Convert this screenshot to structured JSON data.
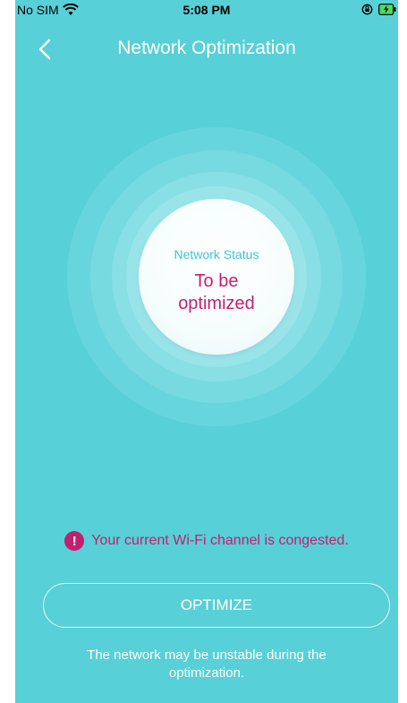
{
  "status_bar": {
    "carrier": "No SIM",
    "time": "5:08 PM",
    "wifi_icon": "wifi-icon",
    "lock_icon": "orientation-lock-icon",
    "battery_icon": "battery-charging-icon"
  },
  "header": {
    "title": "Network Optimization",
    "back_icon": "chevron-left-icon"
  },
  "status": {
    "label": "Network Status",
    "value": "To be optimized"
  },
  "warning": {
    "icon": "exclamation-icon",
    "text": "Your current Wi-Fi channel is congested."
  },
  "actions": {
    "optimize_label": "OPTIMIZE"
  },
  "note": "The network may be unstable during the optimization.",
  "colors": {
    "background": "#57d0d8",
    "accent": "#c41f6f",
    "status_label": "#3ec5cf"
  }
}
